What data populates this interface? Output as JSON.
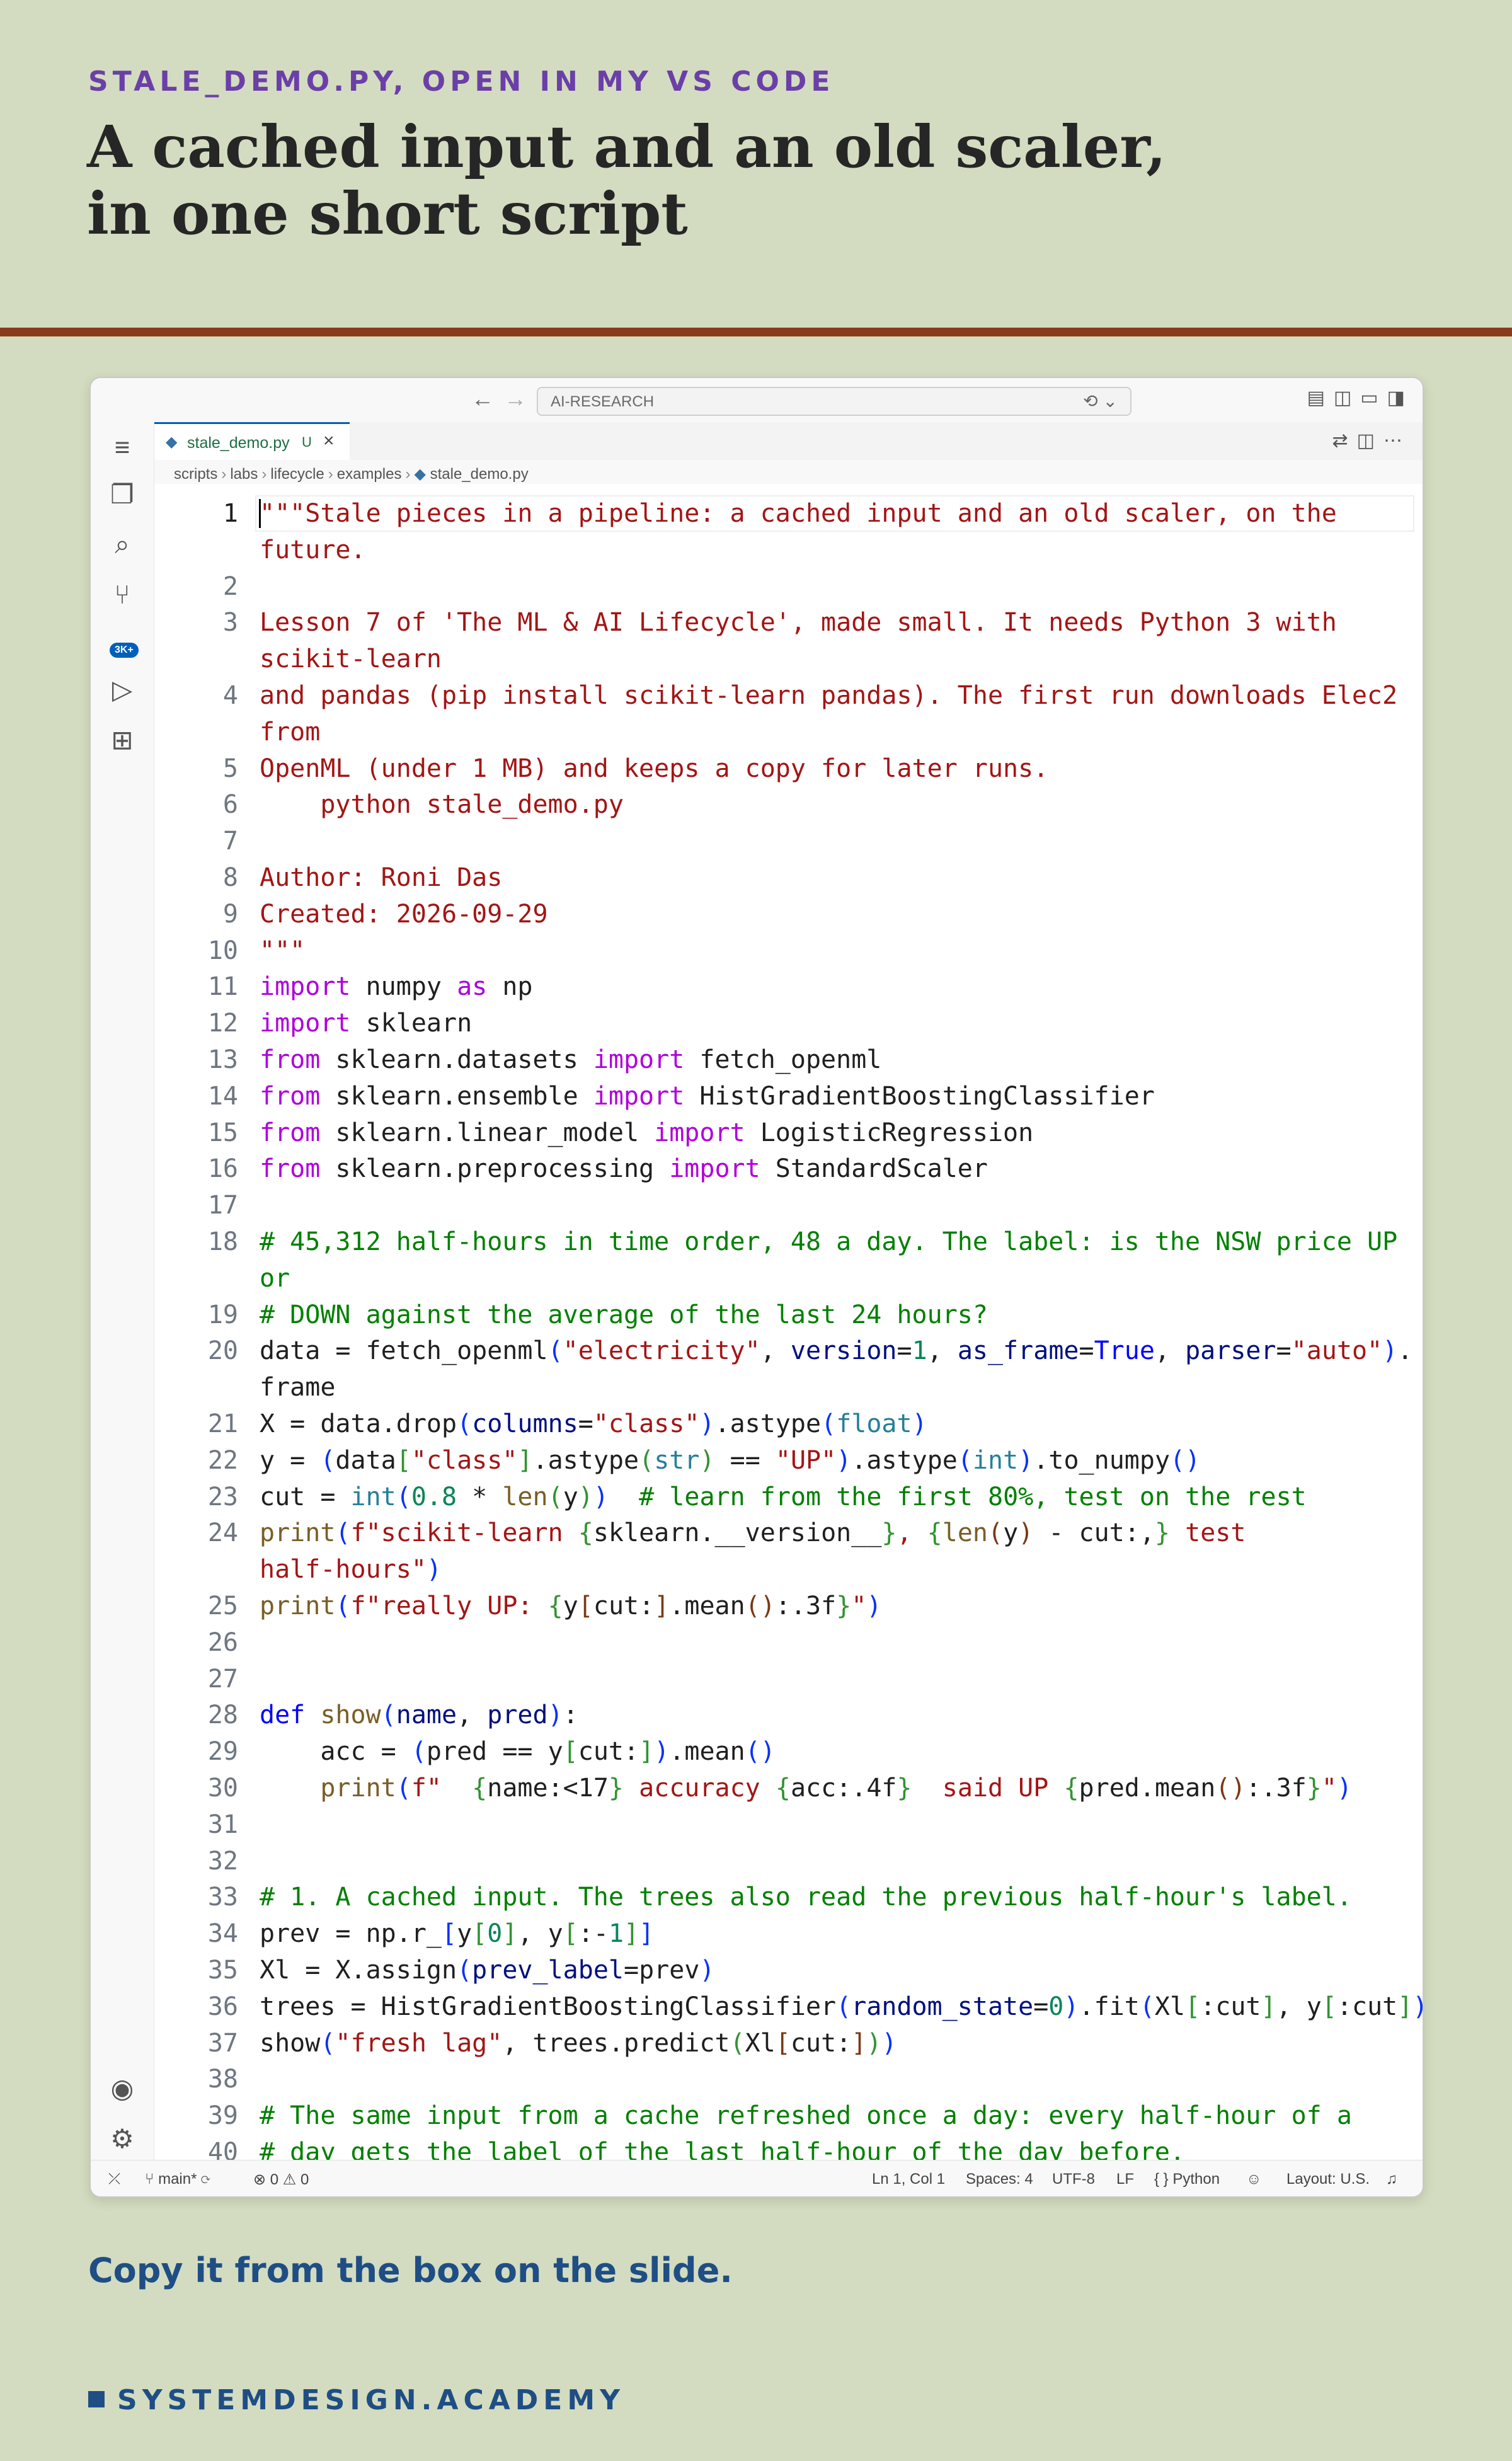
{
  "slide": {
    "kicker": "STALE_DEMO.PY, OPEN IN MY VS CODE",
    "title_line1": "A cached input and an old scaler,",
    "title_line2": "in one short script",
    "footer_note": "Copy it from the box on the slide.",
    "brand": "SYSTEMDESIGN.ACADEMY"
  },
  "window": {
    "command_center": "AI-RESEARCH",
    "tab": {
      "name": "stale_demo.py",
      "modified": "U"
    },
    "breadcrumb": [
      "scripts",
      "labs",
      "lifecycle",
      "examples",
      "stale_demo.py"
    ],
    "scm_badge": "3K+"
  },
  "status_bar": {
    "branch": "main*",
    "errors": "0",
    "warnings": "0",
    "position": "Ln 1, Col 1",
    "spaces": "Spaces: 4",
    "encoding": "UTF-8",
    "eol": "LF",
    "language": "Python",
    "layout": "Layout: U.S."
  },
  "code_lines": [
    {
      "n": "1",
      "segs": [
        [
          "str",
          "\"\"\"Stale pieces in a pipeline: a cached input and an old scaler, on the"
        ]
      ]
    },
    {
      "n": "",
      "segs": [
        [
          "str",
          "future."
        ]
      ]
    },
    {
      "n": "2",
      "segs": []
    },
    {
      "n": "3",
      "segs": [
        [
          "str",
          "Lesson 7 of 'The ML & AI Lifecycle', made small. It needs Python 3 with"
        ]
      ]
    },
    {
      "n": "",
      "segs": [
        [
          "str",
          "scikit-learn"
        ]
      ]
    },
    {
      "n": "4",
      "segs": [
        [
          "str",
          "and pandas (pip install scikit-learn pandas). The first run downloads Elec2"
        ]
      ]
    },
    {
      "n": "",
      "segs": [
        [
          "str",
          "from"
        ]
      ]
    },
    {
      "n": "5",
      "segs": [
        [
          "str",
          "OpenML (under 1 MB) and keeps a copy for later runs."
        ]
      ]
    },
    {
      "n": "6",
      "segs": [
        [
          "str",
          "    python stale_demo.py"
        ]
      ]
    },
    {
      "n": "7",
      "segs": []
    },
    {
      "n": "8",
      "segs": [
        [
          "str",
          "Author: Roni Das"
        ]
      ]
    },
    {
      "n": "9",
      "segs": [
        [
          "str",
          "Created: 2026-09-29"
        ]
      ]
    },
    {
      "n": "10",
      "segs": [
        [
          "str",
          "\"\"\""
        ]
      ]
    },
    {
      "n": "11",
      "segs": [
        [
          "kw",
          "import"
        ],
        [
          "",
          " numpy "
        ],
        [
          "kw",
          "as"
        ],
        [
          "",
          " np"
        ]
      ]
    },
    {
      "n": "12",
      "segs": [
        [
          "kw",
          "import"
        ],
        [
          "",
          " sklearn"
        ]
      ]
    },
    {
      "n": "13",
      "segs": [
        [
          "kw",
          "from"
        ],
        [
          "",
          " sklearn.datasets "
        ],
        [
          "kw",
          "import"
        ],
        [
          "",
          " fetch_openml"
        ]
      ]
    },
    {
      "n": "14",
      "segs": [
        [
          "kw",
          "from"
        ],
        [
          "",
          " sklearn.ensemble "
        ],
        [
          "kw",
          "import"
        ],
        [
          "",
          " HistGradientBoostingClassifier"
        ]
      ]
    },
    {
      "n": "15",
      "segs": [
        [
          "kw",
          "from"
        ],
        [
          "",
          " sklearn.linear_model "
        ],
        [
          "kw",
          "import"
        ],
        [
          "",
          " LogisticRegression"
        ]
      ]
    },
    {
      "n": "16",
      "segs": [
        [
          "kw",
          "from"
        ],
        [
          "",
          " sklearn.preprocessing "
        ],
        [
          "kw",
          "import"
        ],
        [
          "",
          " StandardScaler"
        ]
      ]
    },
    {
      "n": "17",
      "segs": []
    },
    {
      "n": "18",
      "segs": [
        [
          "cm",
          "# 45,312 half-hours in time order, 48 a day. The label: is the NSW price UP"
        ]
      ]
    },
    {
      "n": "",
      "segs": [
        [
          "cm",
          "or"
        ]
      ]
    },
    {
      "n": "19",
      "segs": [
        [
          "cm",
          "# DOWN against the average of the last 24 hours?"
        ]
      ]
    },
    {
      "n": "20",
      "segs": [
        [
          "",
          "data = fetch_openml"
        ],
        [
          "br",
          "("
        ],
        [
          "str",
          "\"electricity\""
        ],
        [
          "",
          ", "
        ],
        [
          "prm",
          "version"
        ],
        [
          "",
          "="
        ],
        [
          "num",
          "1"
        ],
        [
          "",
          ", "
        ],
        [
          "prm",
          "as_frame"
        ],
        [
          "",
          "="
        ],
        [
          "def",
          "True"
        ],
        [
          "",
          ", "
        ],
        [
          "prm",
          "parser"
        ],
        [
          "",
          "="
        ],
        [
          "str",
          "\"auto\""
        ],
        [
          "br",
          ")"
        ],
        [
          "",
          "."
        ]
      ]
    },
    {
      "n": "",
      "segs": [
        [
          "",
          "frame"
        ]
      ]
    },
    {
      "n": "21",
      "segs": [
        [
          "",
          "X = data.drop"
        ],
        [
          "br",
          "("
        ],
        [
          "prm",
          "columns"
        ],
        [
          "",
          "="
        ],
        [
          "str",
          "\"class\""
        ],
        [
          "br",
          ")"
        ],
        [
          "",
          ".astype"
        ],
        [
          "br",
          "("
        ],
        [
          "bt",
          "float"
        ],
        [
          "br",
          ")"
        ]
      ]
    },
    {
      "n": "22",
      "segs": [
        [
          "",
          "y = "
        ],
        [
          "br",
          "("
        ],
        [
          "",
          "data"
        ],
        [
          "br2",
          "["
        ],
        [
          "str",
          "\"class\""
        ],
        [
          "br2",
          "]"
        ],
        [
          "",
          ".astype"
        ],
        [
          "br2",
          "("
        ],
        [
          "bt",
          "str"
        ],
        [
          "br2",
          ")"
        ],
        [
          "",
          " == "
        ],
        [
          "str",
          "\"UP\""
        ],
        [
          "br",
          ")"
        ],
        [
          "",
          ".astype"
        ],
        [
          "br",
          "("
        ],
        [
          "bt",
          "int"
        ],
        [
          "br",
          ")"
        ],
        [
          "",
          ".to_numpy"
        ],
        [
          "br",
          "()"
        ]
      ]
    },
    {
      "n": "23",
      "segs": [
        [
          "",
          "cut = "
        ],
        [
          "bt",
          "int"
        ],
        [
          "br",
          "("
        ],
        [
          "num",
          "0.8"
        ],
        [
          "",
          " * "
        ],
        [
          "fn",
          "len"
        ],
        [
          "br2",
          "("
        ],
        [
          "",
          "y"
        ],
        [
          "br2",
          ")"
        ],
        [
          "br",
          ")"
        ],
        [
          "",
          "  "
        ],
        [
          "cm",
          "# learn from the first 80%, test on the rest"
        ]
      ]
    },
    {
      "n": "24",
      "segs": [
        [
          "fn",
          "print"
        ],
        [
          "br",
          "("
        ],
        [
          "str",
          "f\"scikit-learn "
        ],
        [
          "br2",
          "{"
        ],
        [
          "",
          "sklearn.__version__"
        ],
        [
          "br2",
          "}"
        ],
        [
          "str",
          ", "
        ],
        [
          "br2",
          "{"
        ],
        [
          "fn",
          "len"
        ],
        [
          "br3",
          "("
        ],
        [
          "",
          "y"
        ],
        [
          "br3",
          ")"
        ],
        [
          "",
          " - cut:,"
        ],
        [
          "br2",
          "}"
        ],
        [
          "str",
          " test"
        ]
      ]
    },
    {
      "n": "",
      "segs": [
        [
          "str",
          "half-hours\""
        ],
        [
          "br",
          ")"
        ]
      ]
    },
    {
      "n": "25",
      "segs": [
        [
          "fn",
          "print"
        ],
        [
          "br",
          "("
        ],
        [
          "str",
          "f\"really UP: "
        ],
        [
          "br2",
          "{"
        ],
        [
          "",
          "y"
        ],
        [
          "br3",
          "["
        ],
        [
          "",
          "cut:"
        ],
        [
          "br3",
          "]"
        ],
        [
          "",
          ".mean"
        ],
        [
          "br3",
          "()"
        ],
        [
          "",
          ":.3f"
        ],
        [
          "br2",
          "}"
        ],
        [
          "str",
          "\""
        ],
        [
          "br",
          ")"
        ]
      ]
    },
    {
      "n": "26",
      "segs": []
    },
    {
      "n": "27",
      "segs": []
    },
    {
      "n": "28",
      "segs": [
        [
          "def",
          "def"
        ],
        [
          "",
          " "
        ],
        [
          "fn",
          "show"
        ],
        [
          "br",
          "("
        ],
        [
          "prm",
          "name"
        ],
        [
          "",
          ", "
        ],
        [
          "prm",
          "pred"
        ],
        [
          "br",
          ")"
        ],
        [
          "",
          ":"
        ]
      ]
    },
    {
      "n": "29",
      "segs": [
        [
          "",
          "    acc = "
        ],
        [
          "br",
          "("
        ],
        [
          "",
          "pred == y"
        ],
        [
          "br2",
          "["
        ],
        [
          "",
          "cut:"
        ],
        [
          "br2",
          "]"
        ],
        [
          "br",
          ")"
        ],
        [
          "",
          ".mean"
        ],
        [
          "br",
          "()"
        ]
      ]
    },
    {
      "n": "30",
      "segs": [
        [
          "",
          "    "
        ],
        [
          "fn",
          "print"
        ],
        [
          "br",
          "("
        ],
        [
          "str",
          "f\"  "
        ],
        [
          "br2",
          "{"
        ],
        [
          "",
          "name:<17"
        ],
        [
          "br2",
          "}"
        ],
        [
          "str",
          " accuracy "
        ],
        [
          "br2",
          "{"
        ],
        [
          "",
          "acc:.4f"
        ],
        [
          "br2",
          "}"
        ],
        [
          "str",
          "  said UP "
        ],
        [
          "br2",
          "{"
        ],
        [
          "",
          "pred.mean"
        ],
        [
          "br3",
          "()"
        ],
        [
          "",
          ":.3f"
        ],
        [
          "br2",
          "}"
        ],
        [
          "str",
          "\""
        ],
        [
          "br",
          ")"
        ]
      ]
    },
    {
      "n": "31",
      "segs": []
    },
    {
      "n": "32",
      "segs": []
    },
    {
      "n": "33",
      "segs": [
        [
          "cm",
          "# 1. A cached input. The trees also read the previous half-hour's label."
        ]
      ]
    },
    {
      "n": "34",
      "segs": [
        [
          "",
          "prev = np.r_"
        ],
        [
          "br",
          "["
        ],
        [
          "",
          "y"
        ],
        [
          "br2",
          "["
        ],
        [
          "num",
          "0"
        ],
        [
          "br2",
          "]"
        ],
        [
          "",
          ", y"
        ],
        [
          "br2",
          "["
        ],
        [
          "",
          ":-"
        ],
        [
          "num",
          "1"
        ],
        [
          "br2",
          "]"
        ],
        [
          "br",
          "]"
        ]
      ]
    },
    {
      "n": "35",
      "segs": [
        [
          "",
          "Xl = X.assign"
        ],
        [
          "br",
          "("
        ],
        [
          "prm",
          "prev_label"
        ],
        [
          "",
          "=prev"
        ],
        [
          "br",
          ")"
        ]
      ]
    },
    {
      "n": "36",
      "segs": [
        [
          "",
          "trees = HistGradientBoostingClassifier"
        ],
        [
          "br",
          "("
        ],
        [
          "prm",
          "random_state"
        ],
        [
          "",
          "="
        ],
        [
          "num",
          "0"
        ],
        [
          "br",
          ")"
        ],
        [
          "",
          ".fit"
        ],
        [
          "br",
          "("
        ],
        [
          "",
          "Xl"
        ],
        [
          "br2",
          "["
        ],
        [
          "",
          ":cut"
        ],
        [
          "br2",
          "]"
        ],
        [
          "",
          ", y"
        ],
        [
          "br2",
          "["
        ],
        [
          "",
          ":cut"
        ],
        [
          "br2",
          "]"
        ],
        [
          "br",
          ")"
        ]
      ]
    },
    {
      "n": "37",
      "segs": [
        [
          "",
          "show"
        ],
        [
          "br",
          "("
        ],
        [
          "str",
          "\"fresh lag\""
        ],
        [
          "",
          ", trees.predict"
        ],
        [
          "br2",
          "("
        ],
        [
          "",
          "Xl"
        ],
        [
          "br3",
          "["
        ],
        [
          "",
          "cut:"
        ],
        [
          "br3",
          "]"
        ],
        [
          "br2",
          ")"
        ],
        [
          "br",
          ")"
        ]
      ]
    },
    {
      "n": "38",
      "segs": []
    },
    {
      "n": "39",
      "segs": [
        [
          "cm",
          "# The same input from a cache refreshed once a day: every half-hour of a"
        ]
      ]
    },
    {
      "n": "40",
      "segs": [
        [
          "cm",
          "# day gets the label of the last half-hour of the day before."
        ]
      ]
    }
  ]
}
